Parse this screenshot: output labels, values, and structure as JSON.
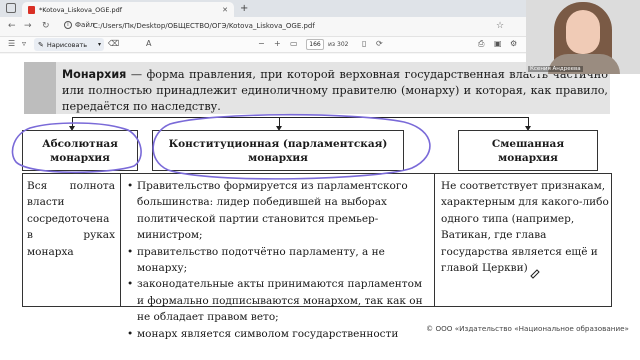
{
  "browser": {
    "tab_title": "*Kotova_Liskova_OGE.pdf",
    "tab_close": "✕",
    "new_tab": "+",
    "info_label": "Файл",
    "url": "C:/Users/Пк/Desktop/ОБЩЕСТВО/ОГЭ/Kotova_Liskova_OGE.pdf"
  },
  "pdf_toolbar": {
    "draw_label": "Нарисовать",
    "zoom_minus": "−",
    "zoom_plus": "+",
    "current_page": "166",
    "page_of": "из 302"
  },
  "definition": {
    "term": "Монархия",
    "text": " — форма правления, при которой верховная государственная власть частично или полностью принадлежит единоличному правителю (монарху) и которая, как правило, передаётся по наследству."
  },
  "types": [
    {
      "header": "Абсолютная монархия",
      "body": "Вся полнота власти сосредоточена в руках монарха"
    },
    {
      "header": "Конституционная (парламентская) монархия",
      "bullets": [
        "Правительство формируется из парламентского большинства: лидер победившей на выборах политической партии становится премьер-министром;",
        "правительство подотчётно парламенту, а не монарху;",
        "законодательные акты принимаются парламентом и формально подписываются монархом, так как он не обладает правом вето;",
        "монарх является символом государственности"
      ]
    },
    {
      "header": "Смешанная монархия",
      "body": "Не соответствует признакам, характерным для какого-либо одного типа (например, Ватикан, где глава государства является ещё и главой Церкви)"
    }
  ],
  "copyright": "© ООО «Издательство «Национальное образование»",
  "webcam": {
    "name": "Ксения Андреева"
  },
  "colors": {
    "annotation": "#7a6ad8",
    "definition_bg": "#e4e4e4",
    "definition_bar": "#bdbdbd"
  }
}
